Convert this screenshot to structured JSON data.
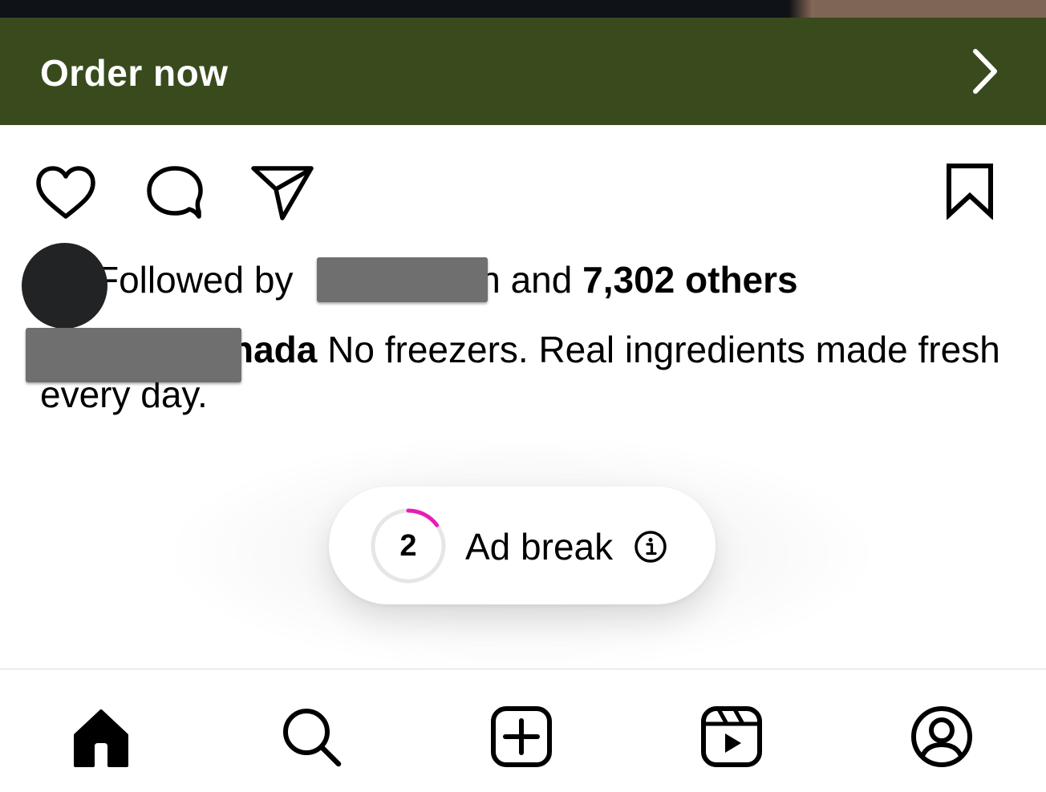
{
  "cta": {
    "label": "Order now",
    "icon": "chevron-right-icon",
    "background": "#394b1d"
  },
  "actions": {
    "icons": [
      "heart-icon",
      "comment-icon",
      "paper-plane-icon",
      "bookmark-icon"
    ]
  },
  "likes": {
    "prefix": "Followed by ",
    "tail": "n and ",
    "count_text": "7,302 others"
  },
  "caption": {
    "user_tail": "nada",
    "text": " No freezers. Real ingredients made fresh every day."
  },
  "ad_break": {
    "countdown": "2",
    "label": "Ad break",
    "progress": 0.15,
    "accent": "#e51eb5"
  },
  "tabbar": {
    "tabs": [
      "home-icon",
      "search-icon",
      "create-icon",
      "reels-icon",
      "profile-icon"
    ]
  }
}
